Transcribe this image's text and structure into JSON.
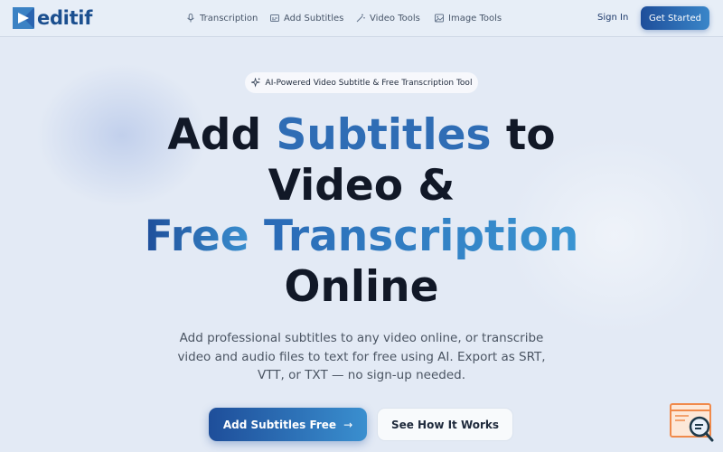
{
  "brand": {
    "name": "editif"
  },
  "nav": {
    "links": [
      {
        "label": "Transcription",
        "icon": "mic-icon"
      },
      {
        "label": "Add Subtitles",
        "icon": "subtitles-icon"
      },
      {
        "label": "Video Tools",
        "icon": "magic-wand-icon"
      },
      {
        "label": "Image Tools",
        "icon": "image-icon"
      }
    ],
    "sign_in": "Sign In",
    "get_started": "Get Started"
  },
  "hero": {
    "badge": "AI-Powered Video Subtitle & Free Transcription Tool",
    "headline": {
      "w1": "Add",
      "w2": "Subtitles",
      "w3": "to",
      "line2": "Video &",
      "line3a": "Free",
      "line3b": "Transcription",
      "line4": "Online"
    },
    "subtitle": "Add professional subtitles to any video online, or transcribe video and audio files to text for free using AI. Export as SRT, VTT, or TXT — no sign-up needed.",
    "primary_cta": "Add Subtitles Free",
    "secondary_cta": "See How It Works"
  },
  "colors": {
    "accent": "#1e4e9a",
    "accent_light": "#3a8fcf",
    "background": "#e3eaf5"
  }
}
